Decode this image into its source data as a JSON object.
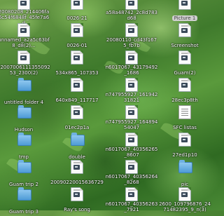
{
  "desktop": {
    "items": [
      {
        "label": "20080208_214406fa6c54f6848f_45fe7a6d",
        "type": "doc",
        "selected": false
      },
      {
        "label": "0026-21",
        "type": "doc",
        "selected": false
      },
      {
        "label": "a58a48742_2c8d783d68",
        "type": "doc",
        "selected": false
      },
      {
        "label": "Picture 1",
        "type": "doc",
        "selected": true
      },
      {
        "label": "unnamed_a2a5c63bf8_d8(2)...",
        "type": "doc",
        "selected": false
      },
      {
        "label": "0026-01",
        "type": "doc",
        "selected": false
      },
      {
        "label": "20080110_cd43f1675_fb7b",
        "type": "doc",
        "selected": false
      },
      {
        "label": "Screenshot",
        "type": "doc",
        "selected": false
      },
      {
        "label": "P200700611135509253_2300(2)",
        "type": "doc",
        "selected": false
      },
      {
        "label": "534x865_107353",
        "type": "doc",
        "selected": false
      },
      {
        "label": "n6017067_43179492_1686",
        "type": "doc",
        "selected": false
      },
      {
        "label": "Guam(2)",
        "type": "doc",
        "selected": false
      },
      {
        "label": "untitled folder 4",
        "type": "folder",
        "selected": false
      },
      {
        "label": "640x849_117717",
        "type": "doc",
        "selected": false
      },
      {
        "label": "n747955927_16194231821",
        "type": "doc",
        "selected": false
      },
      {
        "label": "28ec3p8th",
        "type": "doc",
        "selected": false
      },
      {
        "label": "Hudson",
        "type": "folder",
        "selected": false
      },
      {
        "label": "01ec2p1a",
        "type": "doc",
        "selected": false
      },
      {
        "label": "n747955927_16489454047",
        "type": "doc",
        "selected": false
      },
      {
        "label": "SFC listas",
        "type": "txt",
        "selected": false
      },
      {
        "label": "tmp",
        "type": "folder",
        "selected": false
      },
      {
        "label": "double",
        "type": "folder",
        "selected": false
      },
      {
        "label": "n6017067_40356265_8607",
        "type": "doc",
        "selected": false
      },
      {
        "label": "27ed1p10",
        "type": "doc",
        "selected": false
      },
      {
        "label": "Guam trip 2",
        "type": "folder",
        "selected": false
      },
      {
        "label": "20090220015636729",
        "type": "doc",
        "selected": false
      },
      {
        "label": "n6017067_40356264_8268",
        "type": "doc",
        "selected": false
      },
      {
        "label": "pic",
        "type": "folder",
        "selected": false
      },
      {
        "label": "Guam trip 3",
        "type": "folder",
        "selected": false
      },
      {
        "label": "Ray's song",
        "type": "doc",
        "selected": false
      },
      {
        "label": "n6017067_40356263_7921",
        "type": "doc",
        "selected": false
      },
      {
        "label": "2600_109796876_2471482395_9_n(3)",
        "type": "doc",
        "selected": false
      }
    ]
  }
}
